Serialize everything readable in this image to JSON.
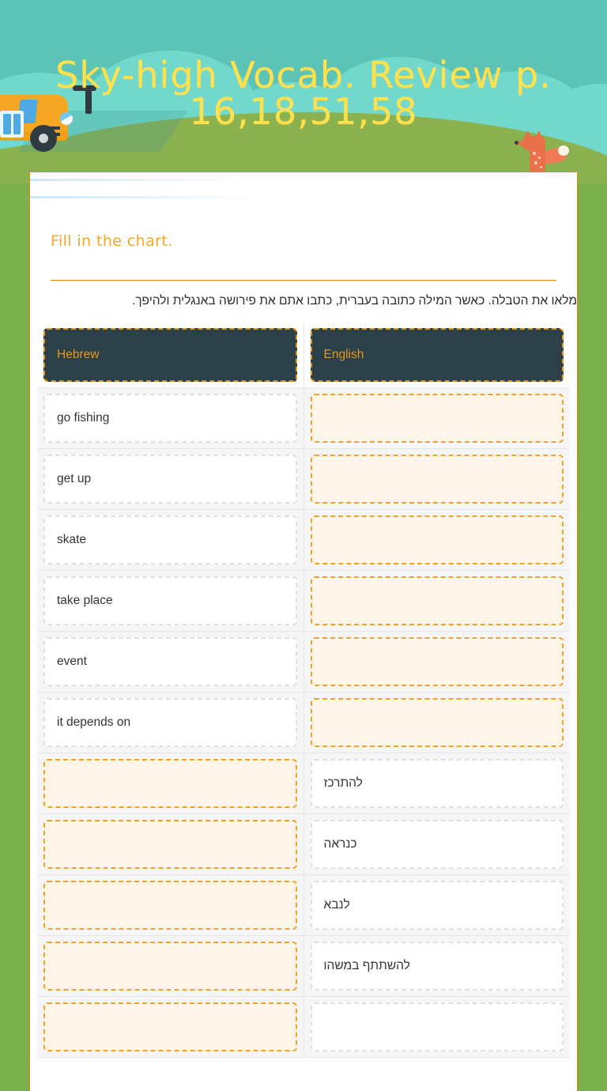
{
  "banner": {
    "title": "Sky-high Vocab. Review p. 16,18,51,58",
    "sky_color": "#5cc3b7",
    "cloud_color": "#72d8cc",
    "grass_color": "#8cb24f",
    "title_color": "#ffe14d",
    "icons": {
      "bus": "school-bus-icon",
      "fox": "fox-icon"
    }
  },
  "page": {
    "background_color": "#7cb04d",
    "card_border_color": "#d98f12",
    "accent_orange": "#e8951c",
    "header_cell_bg": "#2b4047",
    "blank_cell_bg": "#fdf6e8"
  },
  "worksheet": {
    "prompt": "Fill in the chart.",
    "instructions": "מלאו את הטבלה. כאשר המילה כתובה בעברית, כתבו אתם את פירושה באנגלית ולהיפך."
  },
  "table": {
    "headers": {
      "left": "Hebrew",
      "right": "English"
    },
    "rows": [
      {
        "left": "go fishing",
        "left_state": "filled-en",
        "right": "",
        "right_state": "blank"
      },
      {
        "left": "get up",
        "left_state": "filled-en",
        "right": "",
        "right_state": "blank"
      },
      {
        "left": "skate",
        "left_state": "filled-en",
        "right": "",
        "right_state": "blank"
      },
      {
        "left": "take place",
        "left_state": "filled-en",
        "right": "",
        "right_state": "blank"
      },
      {
        "left": "event",
        "left_state": "filled-en",
        "right": "",
        "right_state": "blank"
      },
      {
        "left": "it depends on",
        "left_state": "filled-en",
        "right": "",
        "right_state": "blank"
      },
      {
        "left": "",
        "left_state": "blank",
        "right": "להתרכז",
        "right_state": "filled-he"
      },
      {
        "left": "",
        "left_state": "blank",
        "right": "כנראה",
        "right_state": "filled-he"
      },
      {
        "left": "",
        "left_state": "blank",
        "right": "לנבא",
        "right_state": "filled-he"
      },
      {
        "left": "",
        "left_state": "blank",
        "right": "להשתתף במשהו",
        "right_state": "filled-he"
      },
      {
        "left": "",
        "left_state": "blank",
        "right": "",
        "right_state": "filled-he"
      }
    ]
  }
}
